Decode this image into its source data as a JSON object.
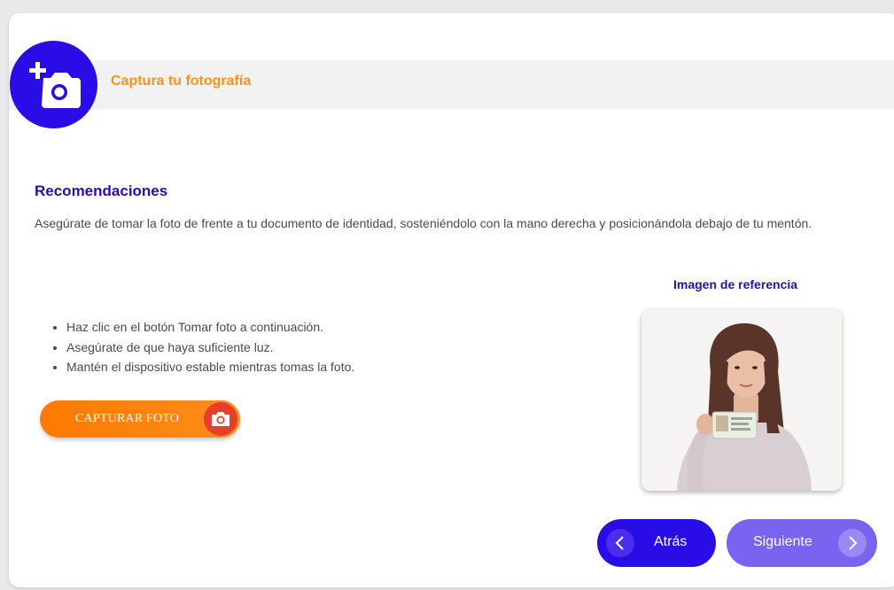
{
  "header": {
    "title": "Captura tu fotografía",
    "icon": "add-photo-icon",
    "accent_color": "#f7941d",
    "badge_color": "#2a0de6"
  },
  "recommendations": {
    "title": "Recomendaciones",
    "text": "Asegúrate de tomar la foto de frente a tu documento de identidad, sosteniéndolo con la mano derecha y posicionándola debajo de tu mentón."
  },
  "steps": [
    "Haz clic en el botón Tomar foto a continuación.",
    "Asegúrate de que haya suficiente luz.",
    "Mantén el dispositivo estable mientras tomas la foto."
  ],
  "capture_button": {
    "label": "CAPTURAR FOTO",
    "icon": "camera-icon"
  },
  "reference": {
    "title": "Imagen de referencia",
    "image_alt": "reference-photo"
  },
  "nav": {
    "back_label": "Atrás",
    "next_label": "Siguiente"
  }
}
